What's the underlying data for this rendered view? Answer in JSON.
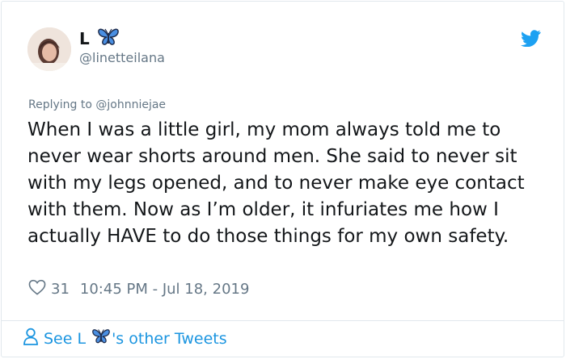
{
  "tweet": {
    "display_name": "L",
    "handle": "@linetteilana",
    "replying_to_prefix": "Replying to",
    "replying_to_handle": "@johnniejae",
    "text": "When I was a little girl, my mom always told me to never wear shorts around men. She said to never sit with my legs opened, and to never make eye contact with them. Now as I’m older, it infuriates me how I actually HAVE to do those things for my own safety.",
    "likes": "31",
    "timestamp": "10:45 PM - Jul 18, 2019"
  },
  "footer": {
    "prefix": "See L",
    "suffix": "'s other Tweets"
  },
  "colors": {
    "accent": "#1da1f2",
    "link": "#1b95e0",
    "muted": "#657786",
    "text": "#14171a",
    "butterfly": "#3a7bd5"
  },
  "icons": {
    "brand": "twitter-bird-icon",
    "emoji": "butterfly-icon",
    "like": "heart-icon",
    "profile": "person-icon"
  }
}
